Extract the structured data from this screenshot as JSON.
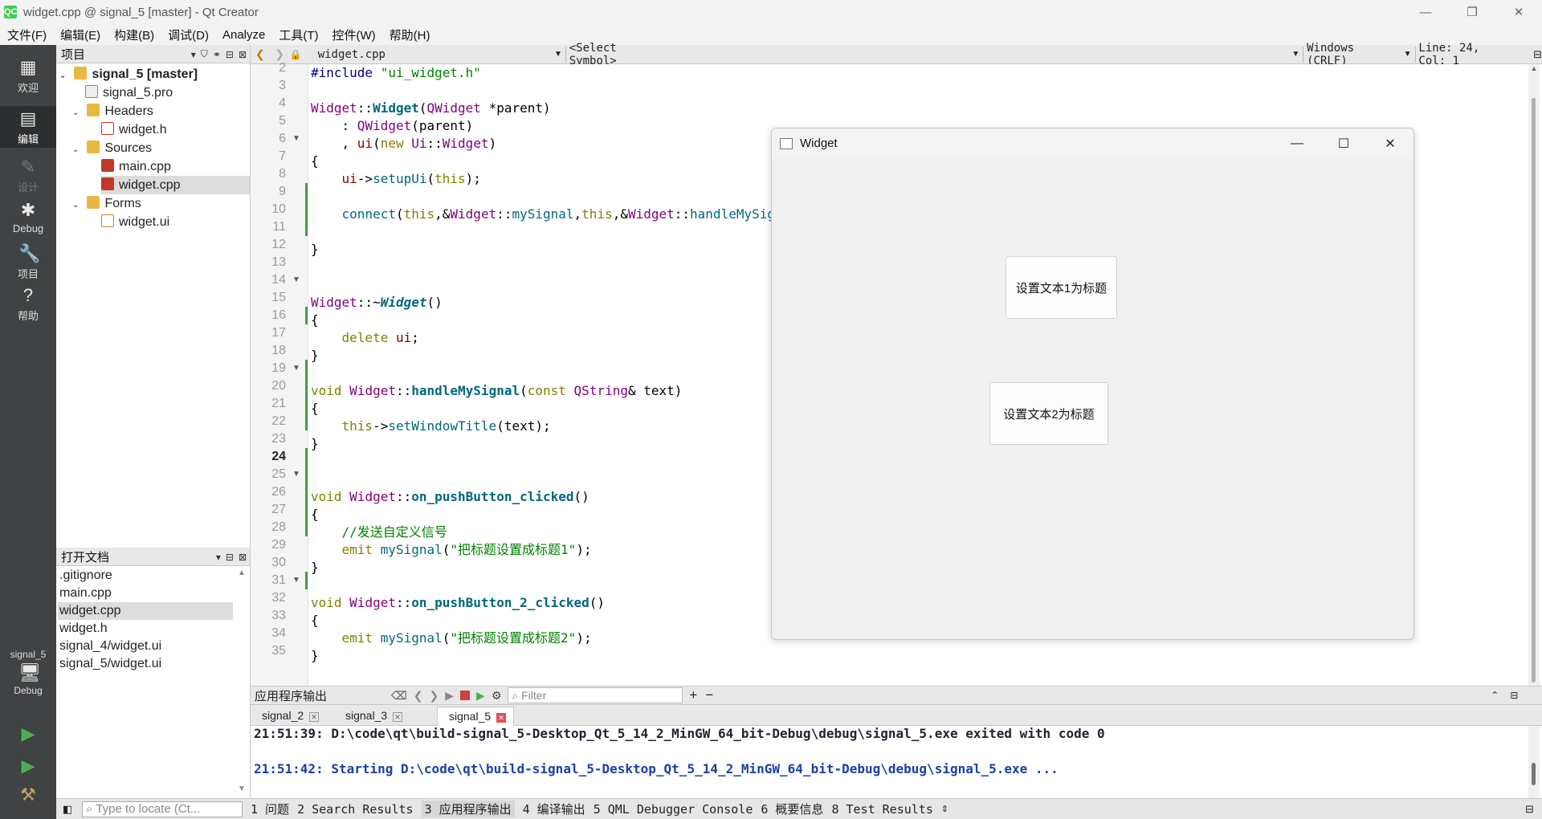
{
  "window": {
    "title": "widget.cpp @ signal_5 [master] - Qt Creator",
    "app_icon": "QC",
    "minimize": "—",
    "restore": "❐",
    "close": "✕"
  },
  "menu": [
    "文件(F)",
    "编辑(E)",
    "构建(B)",
    "调试(D)",
    "Analyze",
    "工具(T)",
    "控件(W)",
    "帮助(H)"
  ],
  "modes": {
    "welcome": "欢迎",
    "edit": "编辑",
    "design": "设计",
    "debug": "Debug",
    "projects": "项目",
    "help": "帮助",
    "kit_project": "signal_5",
    "kit_mode": "Debug"
  },
  "project_pane": {
    "header": "项目",
    "tree": [
      {
        "label": "signal_5 [master]",
        "icon": "project-folder-icon"
      },
      {
        "label": "signal_5.pro",
        "icon": "pro-file-icon"
      },
      {
        "label": "Headers",
        "icon": "folder-icon"
      },
      {
        "label": "widget.h",
        "icon": "header-file-icon"
      },
      {
        "label": "Sources",
        "icon": "folder-icon"
      },
      {
        "label": "main.cpp",
        "icon": "cpp-file-icon"
      },
      {
        "label": "widget.cpp",
        "icon": "cpp-file-icon"
      },
      {
        "label": "Forms",
        "icon": "folder-icon"
      },
      {
        "label": "widget.ui",
        "icon": "ui-file-icon"
      }
    ]
  },
  "open_docs": {
    "header": "打开文档",
    "items": [
      ".gitignore",
      "main.cpp",
      "widget.cpp",
      "widget.h",
      "signal_4/widget.ui",
      "signal_5/widget.ui"
    ]
  },
  "editor_toolbar": {
    "file": "widget.cpp",
    "symbol": "<Select Symbol>",
    "encoding": "Windows (CRLF)",
    "position": "Line: 24, Col: 1"
  },
  "editor": {
    "line_numbers": [
      "2",
      "3",
      "4",
      "5",
      "6",
      "7",
      "8",
      "9",
      "10",
      "11",
      "12",
      "13",
      "14",
      "15",
      "16",
      "17",
      "18",
      "19",
      "20",
      "21",
      "22",
      "23",
      "24",
      "25",
      "26",
      "27",
      "28",
      "29",
      "30",
      "31",
      "32",
      "33",
      "34",
      "35"
    ],
    "current_line": "24",
    "comment_line": "    //发送自定义信号",
    "signal_text_1": "\"把标题设置成标题1\"",
    "signal_text_2": "\"把标题设置成标题2\""
  },
  "widget_window": {
    "title": "Widget",
    "button1": "设置文本1为标题",
    "button2": "设置文本2为标题"
  },
  "output_pane": {
    "header": "应用程序输出",
    "filter_placeholder": "Filter",
    "tabs": [
      "signal_2",
      "signal_3",
      "signal_5"
    ],
    "line1": "21:51:39: D:\\code\\qt\\build-signal_5-Desktop_Qt_5_14_2_MinGW_64_bit-Debug\\debug\\signal_5.exe exited with code 0",
    "line2": "21:51:42: Starting D:\\code\\qt\\build-signal_5-Desktop_Qt_5_14_2_MinGW_64_bit-Debug\\debug\\signal_5.exe ..."
  },
  "statusbar": {
    "locator_placeholder": "Type to locate (Ct...",
    "items": [
      "1 问题",
      "2 Search Results",
      "3 应用程序输出",
      "4 编译输出",
      "5 QML Debugger Console",
      "6 概要信息",
      "8 Test Results"
    ]
  }
}
